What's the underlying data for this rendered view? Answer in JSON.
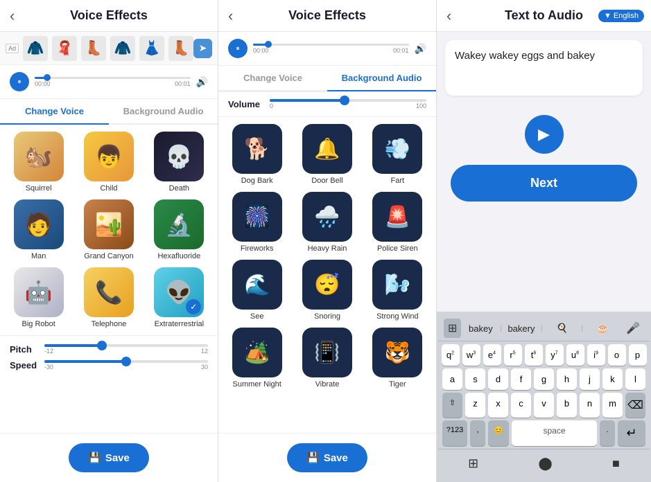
{
  "panels": {
    "left": {
      "header": {
        "back": "‹",
        "title": "Voice Effects",
        "back_aria": "back"
      },
      "ad": {
        "items": [
          "🧥",
          "🧣",
          "👢",
          "🧥",
          "👗",
          "👢"
        ],
        "ad_label": "Ad",
        "arrow": "➤"
      },
      "audio": {
        "time_current": "00:00",
        "time_total": "00:01",
        "progress_pct": 8
      },
      "tabs": [
        {
          "label": "Change Voice",
          "active": true
        },
        {
          "label": "Background Audio",
          "active": false
        }
      ],
      "voices": [
        {
          "id": "squirrel",
          "label": "Squirrel",
          "emoji": "🐿️",
          "class": "squirrel"
        },
        {
          "id": "child",
          "label": "Child",
          "emoji": "👦",
          "class": "child"
        },
        {
          "id": "death",
          "label": "Death",
          "emoji": "💀",
          "class": "death"
        },
        {
          "id": "man",
          "label": "Man",
          "emoji": "🧑",
          "class": "man"
        },
        {
          "id": "grand-canyon",
          "label": "Grand Canyon",
          "emoji": "🏜️",
          "class": "grand-canyon"
        },
        {
          "id": "hexafluoride",
          "label": "Hexafluoride",
          "emoji": "🔬",
          "class": "hexafluoride"
        },
        {
          "id": "big-robot",
          "label": "Big Robot",
          "emoji": "🤖",
          "class": "big-robot"
        },
        {
          "id": "telephone",
          "label": "Telephone",
          "emoji": "📞",
          "class": "telephone"
        },
        {
          "id": "extraterrestrial",
          "label": "Extraterrestrial",
          "emoji": "👽",
          "class": "extraterrestrial"
        }
      ],
      "pitch": {
        "label": "Pitch",
        "min": "-12",
        "max": "12",
        "pct": 35
      },
      "speed": {
        "label": "Speed",
        "min": "-30",
        "max": "30",
        "pct": 50
      },
      "save_label": "Save"
    },
    "middle": {
      "header": {
        "back": "‹",
        "title": "Voice Effects"
      },
      "audio": {
        "time_current": "00:00",
        "time_total": "00:01",
        "progress_pct": 10
      },
      "tabs": [
        {
          "label": "Change Voice",
          "active": false
        },
        {
          "label": "Background Audio",
          "active": true
        }
      ],
      "volume": {
        "label": "Volume",
        "min": "0",
        "max": "100",
        "pct": 48
      },
      "sounds": [
        {
          "id": "dog-bark",
          "label": "Dog Bark",
          "emoji": "🐕"
        },
        {
          "id": "door-bell",
          "label": "Door Bell",
          "emoji": "🔔"
        },
        {
          "id": "fart",
          "label": "Fart",
          "emoji": "💨"
        },
        {
          "id": "fireworks",
          "label": "Fireworks",
          "emoji": "🎆"
        },
        {
          "id": "heavy-rain",
          "label": "Heavy Rain",
          "emoji": "🌧️"
        },
        {
          "id": "police-siren",
          "label": "Police Siren",
          "emoji": "🚨"
        },
        {
          "id": "see",
          "label": "See",
          "emoji": "🌊"
        },
        {
          "id": "snoring",
          "label": "Snoring",
          "emoji": "😴"
        },
        {
          "id": "strong-wind",
          "label": "Strong Wind",
          "emoji": "🌬️"
        },
        {
          "id": "summer-night",
          "label": "Summer Night",
          "emoji": "🏕️"
        },
        {
          "id": "vibrate",
          "label": "Vibrate",
          "emoji": "📳"
        },
        {
          "id": "tiger",
          "label": "Tiger",
          "emoji": "🐯"
        }
      ],
      "save_label": "Save"
    },
    "right": {
      "header": {
        "back": "‹",
        "title": "Text to Audio",
        "badge": "▼ English"
      },
      "text_content": "Wakey wakey eggs and bakey",
      "play_label": "▶",
      "next_label": "Next",
      "keyboard": {
        "suggestions": [
          "bakey",
          "bakery",
          "🍳",
          "🎂"
        ],
        "rows": [
          [
            "q",
            "w",
            "e",
            "r",
            "t",
            "y",
            "u",
            "i",
            "o",
            "p"
          ],
          [
            "a",
            "s",
            "d",
            "f",
            "g",
            "h",
            "j",
            "k",
            "l"
          ],
          [
            "z",
            "x",
            "c",
            "v",
            "b",
            "n",
            "m"
          ],
          [
            "?123",
            ",",
            "😊",
            " ",
            ".",
            "\n",
            "⌫"
          ]
        ],
        "superscripts": [
          "",
          "2",
          "3",
          "4",
          "5",
          "6",
          "7",
          "8",
          "9",
          ""
        ]
      }
    }
  }
}
